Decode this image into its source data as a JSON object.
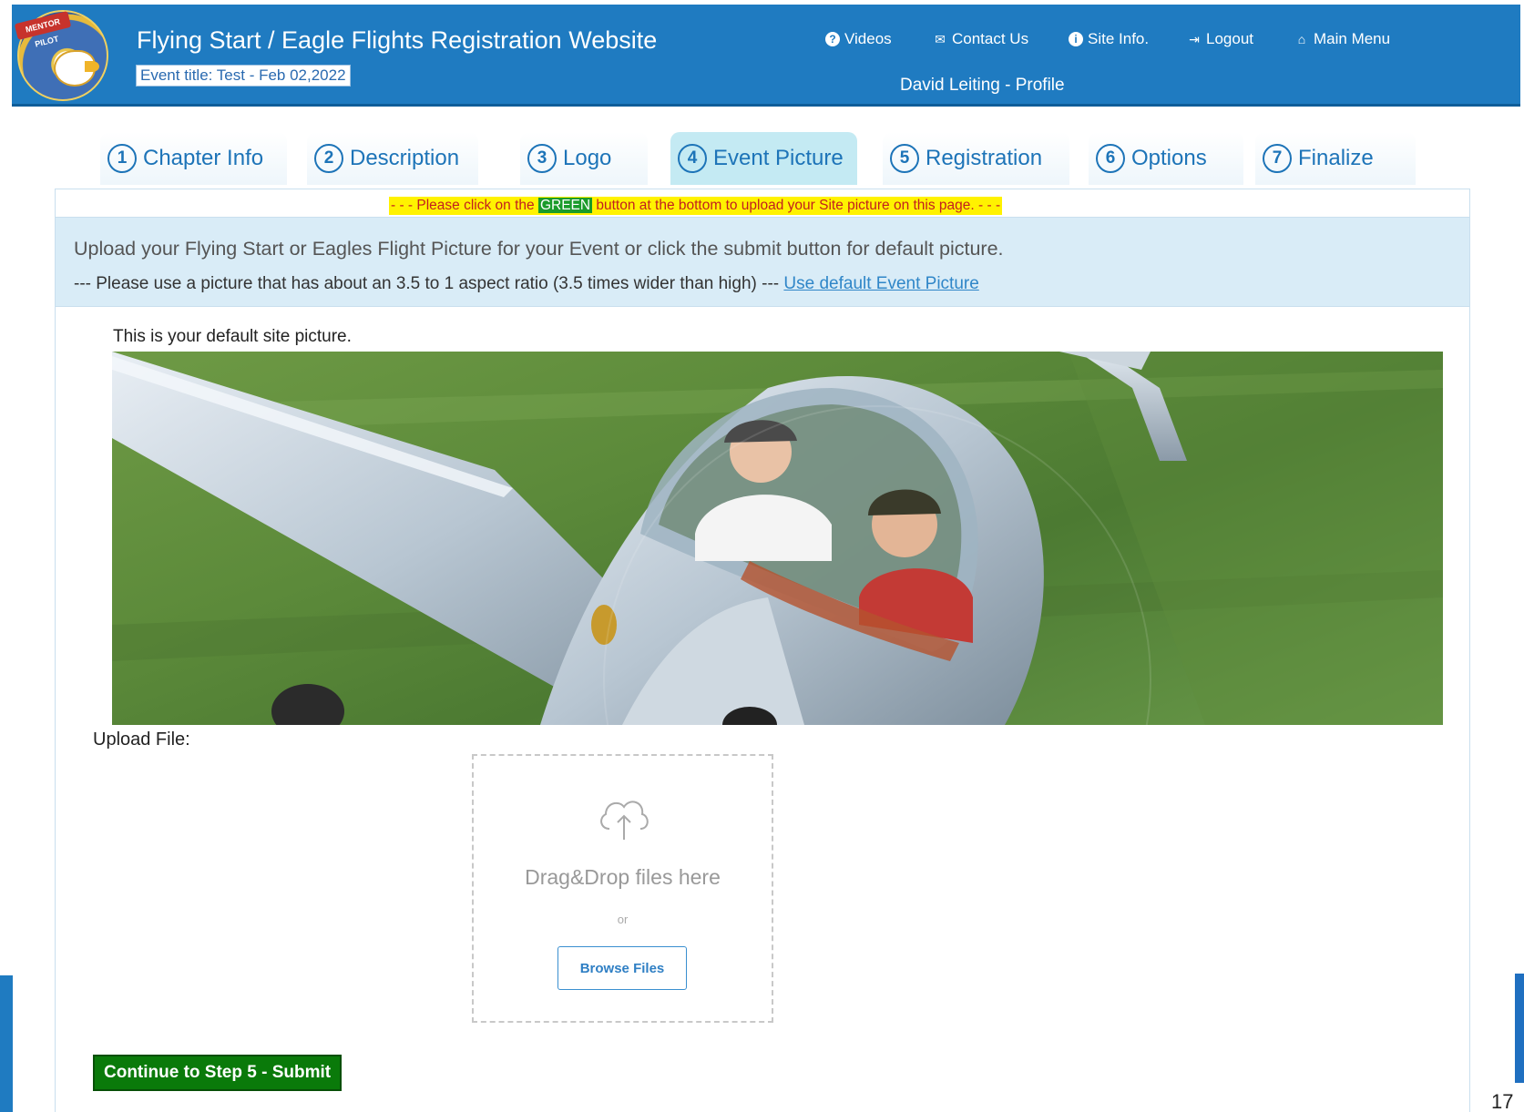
{
  "header": {
    "site_title": "Flying Start / Eagle Flights Registration Website",
    "event_title": "Event title: Test - Feb 02,2022",
    "logo_banner": "MENTOR PILOT",
    "nav": {
      "videos": "Videos",
      "contact": "Contact Us",
      "site_info": "Site Info.",
      "logout": "Logout",
      "main_menu": "Main Menu"
    },
    "profile": "David Leiting - Profile"
  },
  "tabs": [
    {
      "num": "1",
      "label": "Chapter Info"
    },
    {
      "num": "2",
      "label": "Description"
    },
    {
      "num": "3",
      "label": "Logo"
    },
    {
      "num": "4",
      "label": "Event Picture"
    },
    {
      "num": "5",
      "label": "Registration"
    },
    {
      "num": "6",
      "label": "Options"
    },
    {
      "num": "7",
      "label": "Finalize"
    }
  ],
  "active_tab": "Event Picture",
  "notice": {
    "before": "- - - Please click on the ",
    "highlight": "GREEN",
    "after": " button at the bottom to upload your Site picture on this page. - - -"
  },
  "info": {
    "line1": "Upload your Flying Start or Eagles Flight Picture for your Event or click the submit button for default picture.",
    "line2": "--- Please use a picture that has about an 3.5 to 1 aspect ratio (3.5 times wider than high) --- ",
    "default_link": "Use default Event Picture"
  },
  "picture": {
    "label": "This is your default site picture."
  },
  "upload": {
    "label": "Upload File:",
    "drop_text": "Drag&Drop files here",
    "or_text": "or",
    "browse_label": "Browse Files"
  },
  "submit_label": "Continue to Step 5 - Submit",
  "page_number": "17",
  "colors": {
    "header_blue": "#1f7bc1",
    "tab_text": "#1d74b8",
    "active_tab_bg": "#c4eaf3",
    "notice_bg": "#fff200",
    "notice_text": "#c21f1f",
    "submit_green": "#0a7a0a",
    "info_bg": "#d9ecf7"
  }
}
